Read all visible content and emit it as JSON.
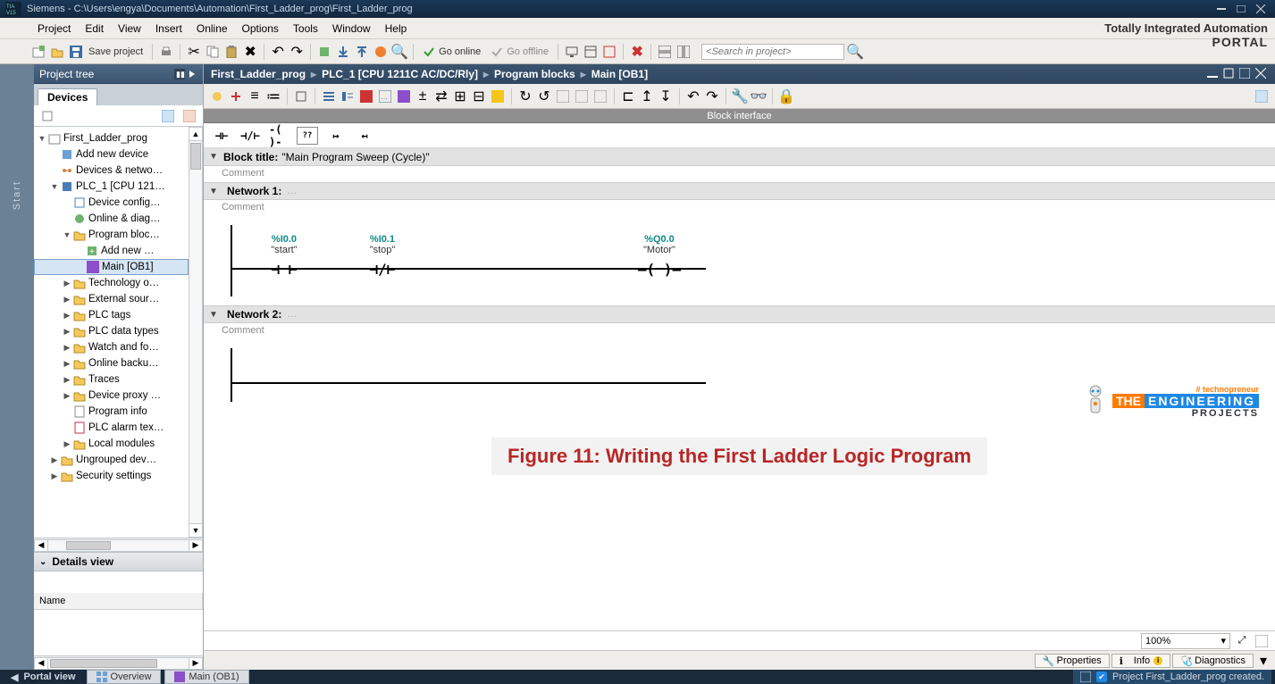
{
  "title_bar": {
    "app": "Siemens",
    "path": "C:\\Users\\engya\\Documents\\Automation\\First_Ladder_prog\\First_Ladder_prog"
  },
  "menu": [
    "Project",
    "Edit",
    "View",
    "Insert",
    "Online",
    "Options",
    "Tools",
    "Window",
    "Help"
  ],
  "branding": {
    "line1": "Totally Integrated Automation",
    "line2": "PORTAL"
  },
  "toolbar": {
    "save_label": "Save project",
    "go_online": "Go online",
    "go_offline": "Go offline",
    "search_placeholder": "<Search in project>"
  },
  "project_tree": {
    "header": "Project tree",
    "tab": "Devices",
    "items": [
      {
        "ind": 0,
        "exp": "▼",
        "icon": "project",
        "label": "First_Ladder_prog"
      },
      {
        "ind": 1,
        "exp": "",
        "icon": "add-device",
        "label": "Add new device"
      },
      {
        "ind": 1,
        "exp": "",
        "icon": "network",
        "label": "Devices & netwo…"
      },
      {
        "ind": 1,
        "exp": "▼",
        "icon": "plc",
        "label": "PLC_1 [CPU 121…"
      },
      {
        "ind": 2,
        "exp": "",
        "icon": "device-config",
        "label": "Device config…"
      },
      {
        "ind": 2,
        "exp": "",
        "icon": "online-diag",
        "label": "Online & diag…"
      },
      {
        "ind": 2,
        "exp": "▼",
        "icon": "folder",
        "label": "Program bloc…"
      },
      {
        "ind": 3,
        "exp": "",
        "icon": "add-block",
        "label": "Add new …"
      },
      {
        "ind": 3,
        "exp": "",
        "icon": "ob-block",
        "label": "Main [OB1]",
        "selected": true
      },
      {
        "ind": 2,
        "exp": "▶",
        "icon": "folder",
        "label": "Technology o…"
      },
      {
        "ind": 2,
        "exp": "▶",
        "icon": "folder",
        "label": "External sour…"
      },
      {
        "ind": 2,
        "exp": "▶",
        "icon": "folder",
        "label": "PLC tags"
      },
      {
        "ind": 2,
        "exp": "▶",
        "icon": "folder",
        "label": "PLC data types"
      },
      {
        "ind": 2,
        "exp": "▶",
        "icon": "folder",
        "label": "Watch and fo…"
      },
      {
        "ind": 2,
        "exp": "▶",
        "icon": "folder",
        "label": "Online backu…"
      },
      {
        "ind": 2,
        "exp": "▶",
        "icon": "folder",
        "label": "Traces"
      },
      {
        "ind": 2,
        "exp": "▶",
        "icon": "folder",
        "label": "Device proxy …"
      },
      {
        "ind": 2,
        "exp": "",
        "icon": "prog-info",
        "label": "Program info"
      },
      {
        "ind": 2,
        "exp": "",
        "icon": "alarm",
        "label": "PLC alarm tex…"
      },
      {
        "ind": 2,
        "exp": "▶",
        "icon": "folder",
        "label": "Local modules"
      },
      {
        "ind": 1,
        "exp": "▶",
        "icon": "folder",
        "label": "Ungrouped dev…"
      },
      {
        "ind": 1,
        "exp": "▶",
        "icon": "folder",
        "label": "Security settings"
      }
    ],
    "details_header": "Details view",
    "details_col": "Name"
  },
  "editor": {
    "breadcrumb": [
      "First_Ladder_prog",
      "PLC_1 [CPU 1211C AC/DC/Rly]",
      "Program blocks",
      "Main [OB1]"
    ],
    "block_interface": "Block interface",
    "block_title_label": "Block title:",
    "block_title_value": "\"Main Program Sweep (Cycle)\"",
    "comment_label": "Comment",
    "networks": [
      {
        "label": "Network 1:",
        "comment": "Comment",
        "nodes": [
          {
            "addr": "%I0.0",
            "tag": "\"start\"",
            "sym": "⊢ ⊣",
            "type": "no-contact"
          },
          {
            "addr": "%I0.1",
            "tag": "\"stop\"",
            "sym": "⊢/⊣",
            "type": "nc-contact"
          },
          {
            "addr": "%Q0.0",
            "tag": "\"Motor\"",
            "sym": "―( )―",
            "type": "coil"
          }
        ]
      },
      {
        "label": "Network 2:",
        "comment": "Comment",
        "nodes": []
      }
    ],
    "zoom": "100%"
  },
  "property_tabs": [
    {
      "icon": "properties",
      "label": "Properties"
    },
    {
      "icon": "info",
      "label": "Info",
      "badge": "i"
    },
    {
      "icon": "diagnostics",
      "label": "Diagnostics"
    }
  ],
  "footer": {
    "portal_view": "Portal view",
    "tabs": [
      {
        "icon": "overview",
        "label": "Overview"
      },
      {
        "icon": "ob-block",
        "label": "Main (OB1)"
      }
    ],
    "status": "Project First_Ladder_prog created."
  },
  "figure_caption": "Figure 11: Writing the First Ladder Logic Program",
  "watermark": {
    "hash": "# technopreneur",
    "the": "THE",
    "eng": "ENGINEERING",
    "prj": "PROJECTS"
  },
  "left_rail": {
    "start": "Start"
  }
}
